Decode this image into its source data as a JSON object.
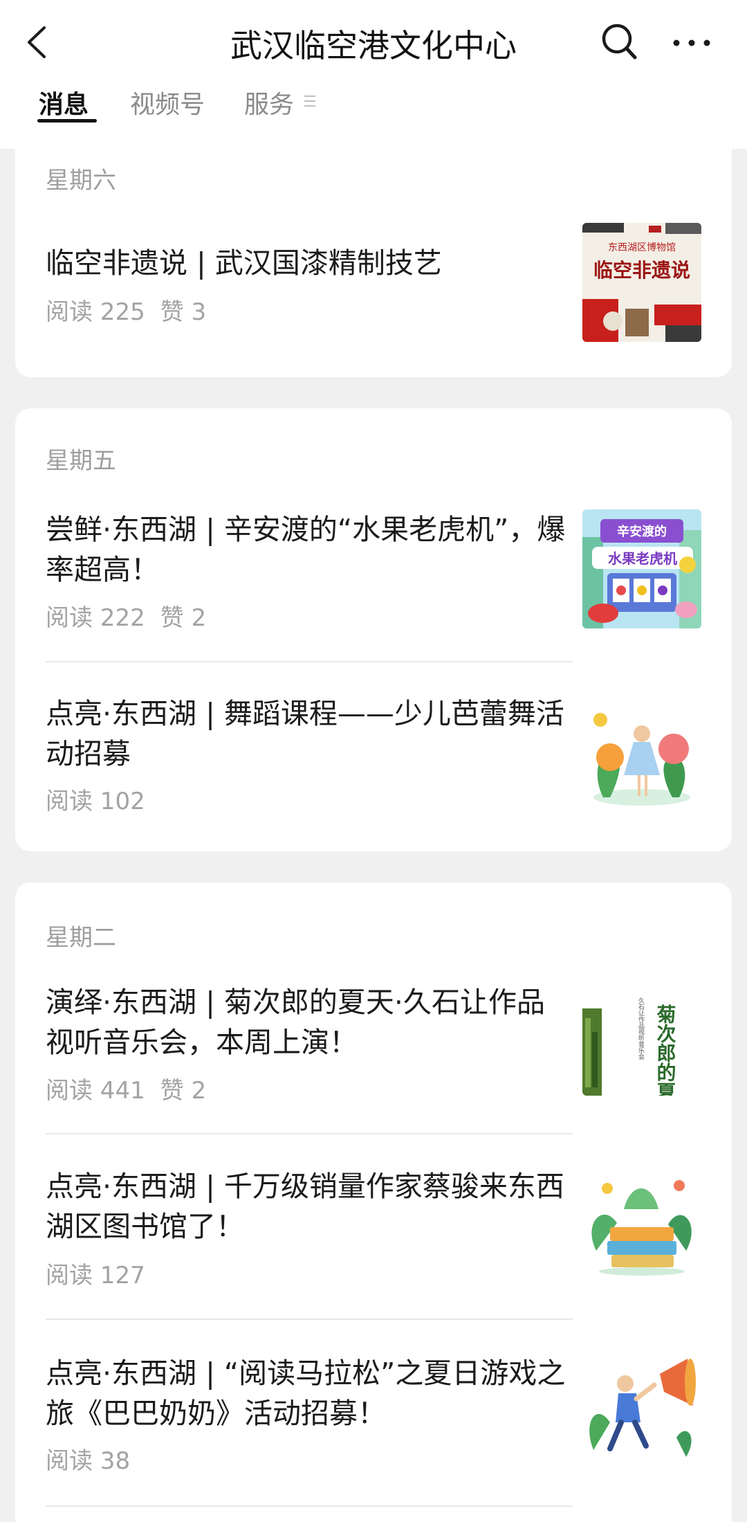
{
  "header": {
    "title": "武汉临空港文化中心"
  },
  "tabs": [
    {
      "label": "消息"
    },
    {
      "label": "视频号"
    },
    {
      "label": "服务"
    }
  ],
  "cards": [
    {
      "day": "星期六",
      "articles": [
        {
          "title": "临空非遗说 | 武汉国漆精制技艺",
          "reads": "阅读 225",
          "likes": "赞 3",
          "thumb": {
            "top": "东西湖区博物馆",
            "main": "临空非遗说"
          }
        }
      ]
    },
    {
      "day": "星期五",
      "articles": [
        {
          "title": "尝鲜·东西湖 | 辛安渡的“水果老虎机”，爆率超高！",
          "reads": "阅读 222",
          "likes": "赞 2",
          "thumb": {
            "line1": "辛安渡的",
            "line2": "水果老虎机"
          }
        },
        {
          "title": "点亮·东西湖 | 舞蹈课程——少儿芭蕾舞活动招募",
          "reads": "阅读 102",
          "likes": ""
        }
      ]
    },
    {
      "day": "星期二",
      "articles": [
        {
          "title": "演绎·东西湖 | 菊次郎的夏天·久石让作品视听音乐会，本周上演！",
          "reads": "阅读 441",
          "likes": "赞 2",
          "thumb": {
            "main": "菊次郎的夏天",
            "side": "久石让作品视听音乐会"
          }
        },
        {
          "title": "点亮·东西湖 | 千万级销量作家蔡骏来东西湖区图书馆了！",
          "reads": "阅读 127",
          "likes": ""
        },
        {
          "title": "点亮·东西湖 | “阅读马拉松”之夏日游戏之旅《巴巴奶奶》活动招募！",
          "reads": "阅读 38",
          "likes": ""
        }
      ]
    }
  ]
}
